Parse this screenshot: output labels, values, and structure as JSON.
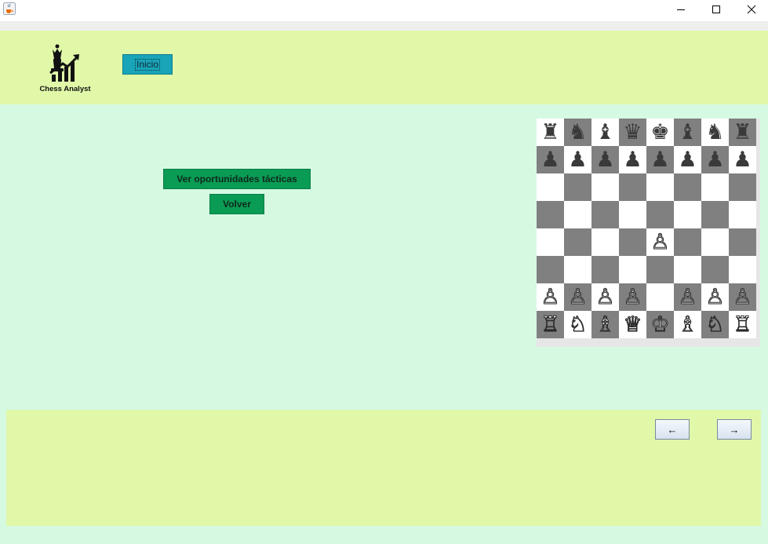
{
  "window": {
    "icon": "java-cup-icon",
    "controls": [
      "minimize-icon",
      "maximize-icon",
      "close-icon"
    ]
  },
  "header": {
    "logo_text": "Chess Analyst",
    "inicio_label": "Inicio"
  },
  "main": {
    "tactics_button": "Ver oportunidades tácticas",
    "back_button": "Volver"
  },
  "board": {
    "light_color": "#ffffff",
    "dark_color": "#808080",
    "rows": [
      [
        "♜",
        "♞",
        "♝",
        "♛",
        "♚",
        "♝",
        "♞",
        "♜"
      ],
      [
        "♟",
        "♟",
        "♟",
        "♟",
        "♟",
        "♟",
        "♟",
        "♟"
      ],
      [
        "",
        "",
        "",
        "",
        "",
        "",
        "",
        ""
      ],
      [
        "",
        "",
        "",
        "",
        "",
        "",
        "",
        ""
      ],
      [
        "",
        "",
        "",
        "",
        "♙",
        "",
        "",
        ""
      ],
      [
        "",
        "",
        "",
        "",
        "",
        "",
        "",
        ""
      ],
      [
        "♙",
        "♙",
        "♙",
        "♙",
        "",
        "♙",
        "♙",
        "♙"
      ],
      [
        "♖",
        "♘",
        "♗",
        "♕",
        "♔",
        "♗",
        "♘",
        "♖"
      ]
    ]
  },
  "footer": {
    "prev_label": "←",
    "next_label": "→"
  }
}
